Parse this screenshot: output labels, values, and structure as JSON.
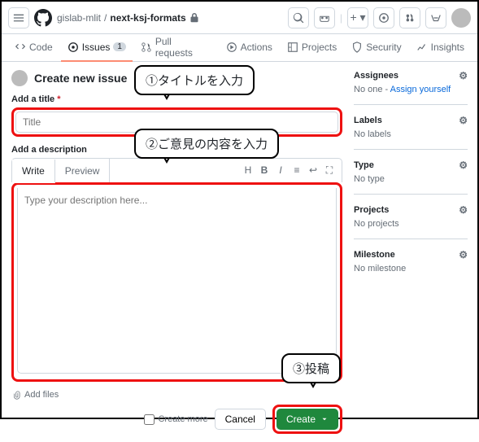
{
  "breadcrumb": {
    "owner": "gislab-mlit",
    "repo": "next-ksj-formats"
  },
  "nav": {
    "code": "Code",
    "issues": "Issues",
    "issues_count": "1",
    "pulls": "Pull requests",
    "actions": "Actions",
    "projects": "Projects",
    "security": "Security",
    "insights": "Insights"
  },
  "page": {
    "title": "Create new issue"
  },
  "form": {
    "title_label": "Add a title",
    "title_placeholder": "Title",
    "desc_label": "Add a description",
    "write_tab": "Write",
    "preview_tab": "Preview",
    "desc_placeholder": "Type your description here...",
    "add_files": "Add files",
    "create_more": "Create more",
    "cancel": "Cancel",
    "create": "Create"
  },
  "sidebar": {
    "assignees": {
      "label": "Assignees",
      "text": "No one - ",
      "link": "Assign yourself"
    },
    "labels": {
      "label": "Labels",
      "text": "No labels"
    },
    "type": {
      "label": "Type",
      "text": "No type"
    },
    "projects": {
      "label": "Projects",
      "text": "No projects"
    },
    "milestone": {
      "label": "Milestone",
      "text": "No milestone"
    }
  },
  "callouts": {
    "c1": "①タイトルを入力",
    "c2": "②ご意見の内容を入力",
    "c3": "③投稿"
  }
}
